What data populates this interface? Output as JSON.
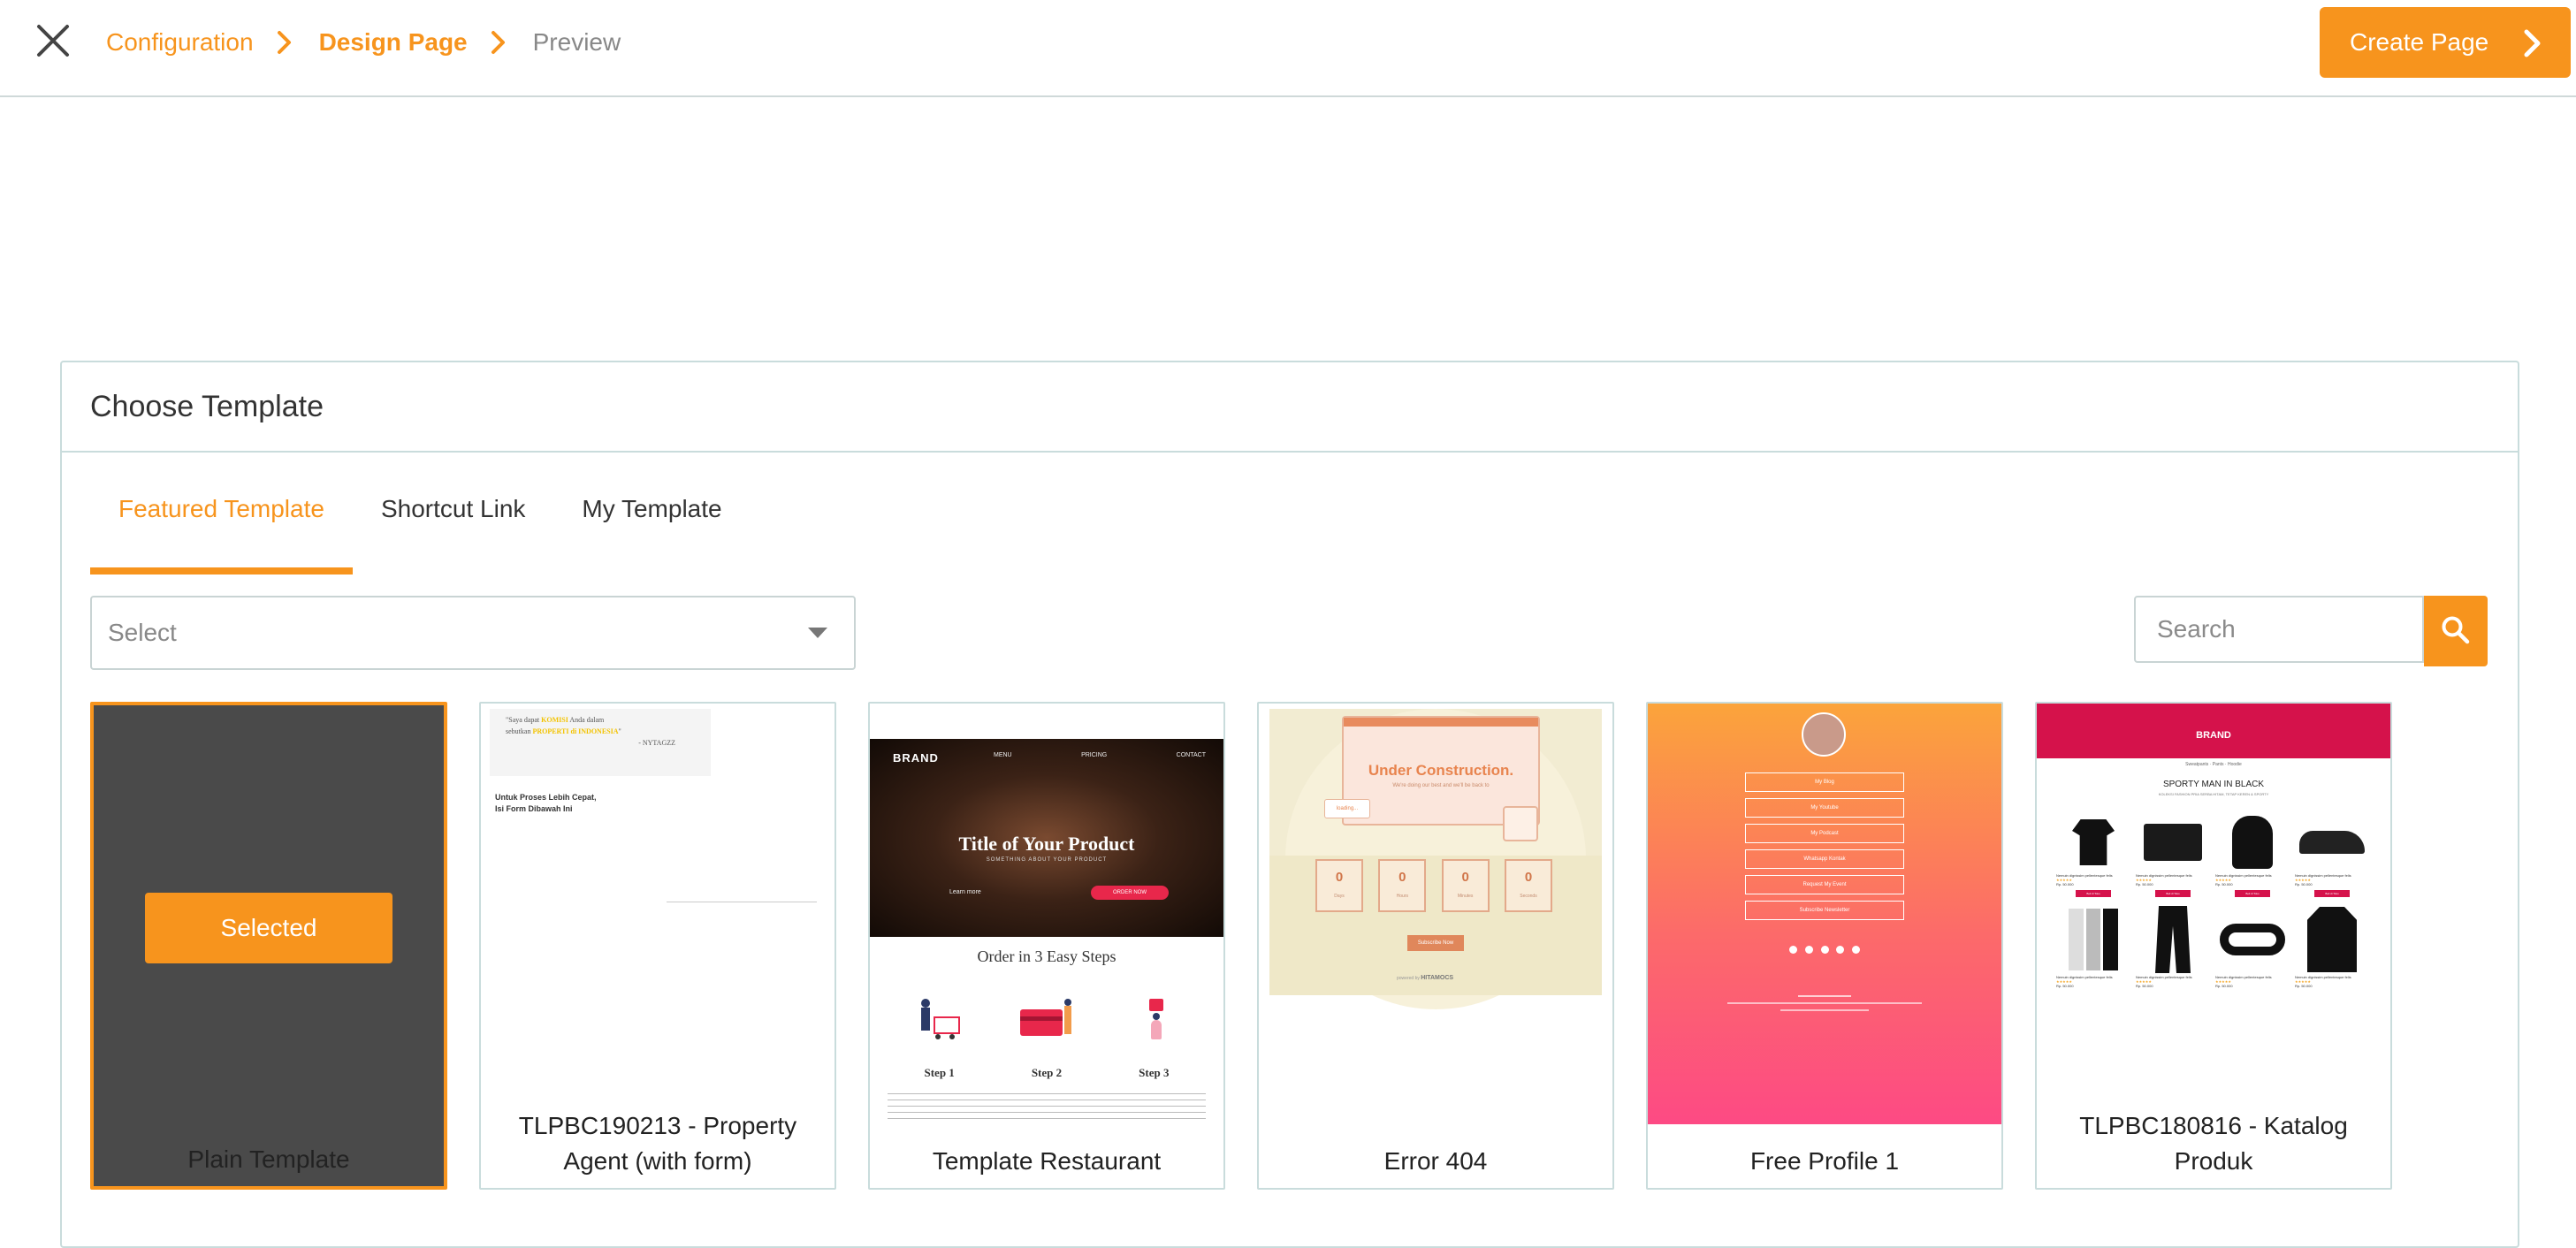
{
  "header": {
    "breadcrumb": [
      "Configuration",
      "Design Page",
      "Preview"
    ],
    "create_label": "Create Page"
  },
  "panel": {
    "title": "Choose Template",
    "tabs": [
      "Featured Template",
      "Shortcut Link",
      "My Template"
    ],
    "select_placeholder": "Select",
    "search_placeholder": "Search"
  },
  "templates": [
    {
      "name": "Plain Template",
      "status": "Selected"
    },
    {
      "name": "TLPBC190213 - Property Agent (with form)"
    },
    {
      "name": "Template Restaurant"
    },
    {
      "name": "Error 404"
    },
    {
      "name": "Free Profile 1"
    },
    {
      "name": "TLPBC180816 - Katalog Produk"
    }
  ],
  "previews": {
    "property": {
      "quote_a": "\"Saya dapat ",
      "quote_hl1": "KOMISI",
      "quote_b": " Anda dalam",
      "quote_c": "sebutkan ",
      "quote_hl2": "PROPERTI di INDONESIA",
      "quote_d": "\"",
      "quote_sig": "- NYTAGZZ",
      "form_title": "Untuk Proses Lebih Cepat,",
      "form_sub": "Isi Form Dibawah Ini"
    },
    "restaurant": {
      "brand": "BRAND",
      "nav": [
        "MENU",
        "PRICING",
        "CONTACT"
      ],
      "title": "Title of Your Product",
      "sub": "SOMETHING ABOUT YOUR PRODUCT",
      "link": "Learn more",
      "cta": "ORDER NOW",
      "steps_title": "Order in 3 Easy Steps",
      "steps": [
        "Step 1",
        "Step 2",
        "Step 3"
      ]
    },
    "error": {
      "title": "Under Construction.",
      "sub": "We're doing our best and we'll be back to",
      "loading": "loading...",
      "counts": [
        "0",
        "0",
        "0",
        "0"
      ],
      "count_labels": [
        "Days",
        "Hours",
        "Minutes",
        "Seconds"
      ],
      "button": "Subscribe Now",
      "powered": "powered by",
      "logo": "HITAMOCS"
    },
    "profile": {
      "links": [
        "My Blog",
        "My Youtube",
        "My Podcast",
        "Whatsapp Kontak",
        "Request My Event",
        "Subscribe Newsletter"
      ]
    },
    "catalog": {
      "brand": "BRAND",
      "nav": [
        "Sweatpants",
        "Pants",
        "Hoodie"
      ],
      "title": "SPORTY MAN IN BLACK",
      "sub": "KOLEKSI FASHION PRIA SERBA HITAM, TETAP KEREN & SPORTY",
      "product_name": "Nemuin dignissim pellentesque felis",
      "price": "Rp. 50.000",
      "buy": "Beli di Toko"
    }
  },
  "colors": {
    "accent": "#f7941d",
    "border": "#c9dcdc",
    "selected_bg": "#4a4a4a",
    "catalog_brand": "#d5124b"
  }
}
